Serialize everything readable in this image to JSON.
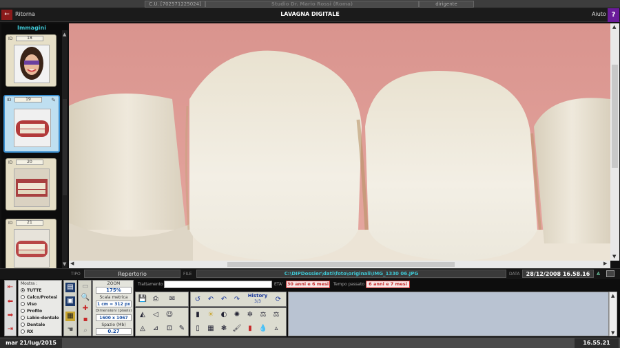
{
  "topbar": {
    "cu": "C.U. [702571225024]",
    "studio": "Studio Dr. Mario Rossi (Roma)",
    "role": "dirigente"
  },
  "header": {
    "back_label": "Ritorna",
    "title": "LAVAGNA DIGITALE",
    "help_label": "Aiuto",
    "help_icon": "?",
    "back_icon": "←"
  },
  "sidebar": {
    "title": "Immagini",
    "id_label": "ID",
    "items": [
      {
        "id": "18"
      },
      {
        "id": "19"
      },
      {
        "id": "20"
      },
      {
        "id": "21"
      }
    ]
  },
  "infobar": {
    "tipo_label": "TIPO",
    "tipo_value": "Repertorio",
    "file_label": "FILE",
    "file_value": "C:\\DIPDossier\\dati\\foto\\originali\\IMG_1330 06.JPG",
    "data_label": "DATA",
    "data_value": "28/12/2008 16.58.16"
  },
  "show": {
    "title": "Mostra :",
    "options": [
      "TUTTE",
      "Calco/Protesi",
      "Viso",
      "Profilo",
      "Labio-dentale",
      "Dentale",
      "RX"
    ],
    "selected": "TUTTE"
  },
  "zoom": {
    "label": "ZOOM",
    "value": "175%",
    "scale_label": "Scala metrica",
    "scale_value": "1 cm = 312 px",
    "dim_label": "Dimensioni (pixels)",
    "dim_value": "1600 x 1067",
    "space_label": "Spazio (Mb)",
    "space_value": "0.27"
  },
  "treatment": {
    "label": "Trattamento",
    "value": "",
    "eta_label": "ETA'",
    "eta_value": "30 anni e 6 mesi",
    "elapsed_label": "Tempo passato",
    "elapsed_value": "6 anni e 7 mesi"
  },
  "history": {
    "label": "History",
    "value": "3/3"
  },
  "status": {
    "date": "mar 21/lug/2015",
    "time": "16.55.21"
  },
  "colors": {
    "accent_cyan": "#3fc7d4",
    "selected_border": "#3a8fd0",
    "back_red": "#8b1a1a",
    "help_purple": "#6a1b9a",
    "age_red": "#c62828"
  }
}
